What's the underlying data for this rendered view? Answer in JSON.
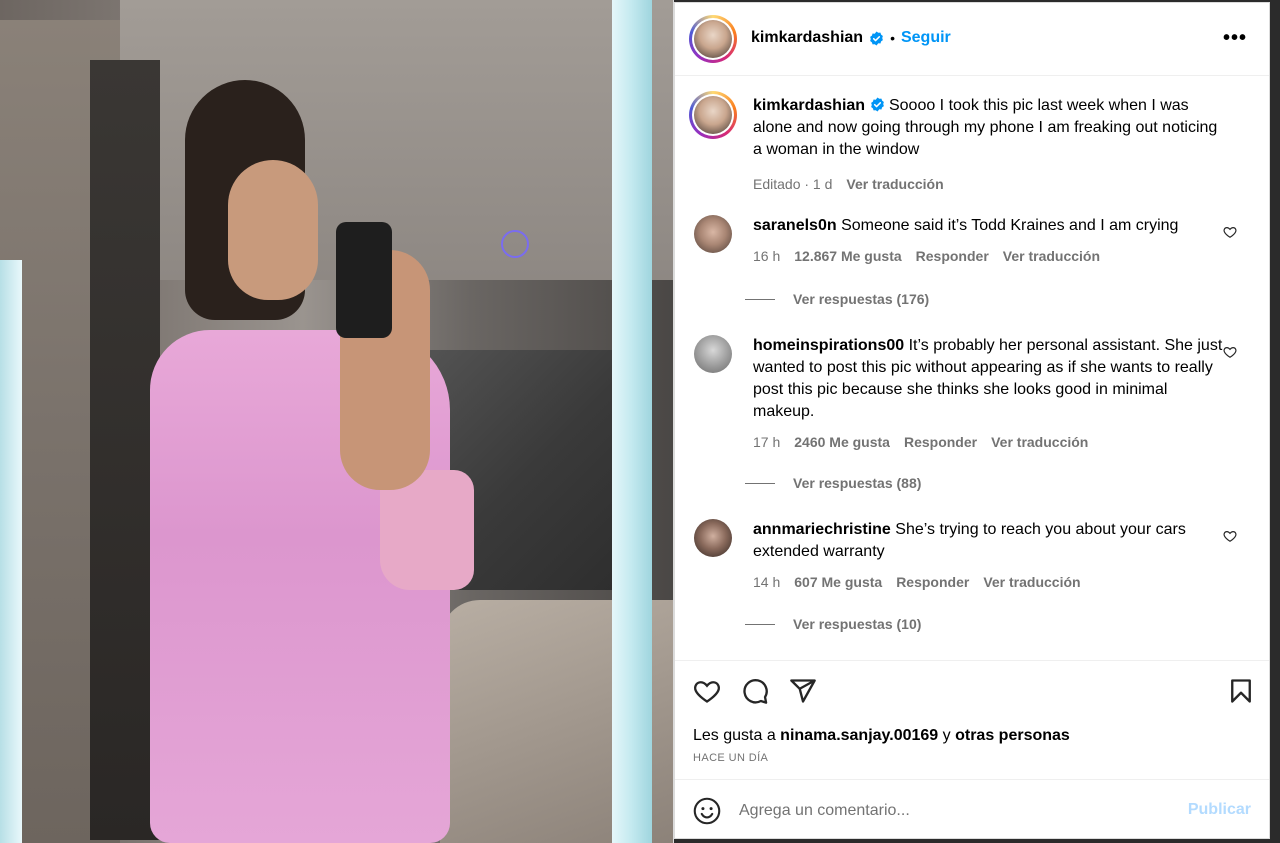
{
  "post": {
    "username": "kimkardashian",
    "follow_label": "Seguir",
    "separator": "•",
    "more_label": "•••"
  },
  "caption": {
    "username": "kimkardashian",
    "text": "Soooo I took this pic last week when I was alone and now going through my phone I am freaking out noticing a woman in the window",
    "edited": "Editado · 1 d",
    "translate": "Ver traducción"
  },
  "comments": [
    {
      "username": "saranels0n",
      "text": "Someone said it’s Todd Kraines and I am crying",
      "time": "16 h",
      "likes": "12.867 Me gusta",
      "reply": "Responder",
      "translate": "Ver traducción",
      "replies": "Ver respuestas (176)"
    },
    {
      "username": "homeinspirations00",
      "text": "It’s probably her personal assistant. She just wanted to post this pic without appearing as if she wants to really post this pic because she thinks she looks good in minimal makeup.",
      "time": "17 h",
      "likes": "2460 Me gusta",
      "reply": "Responder",
      "translate": "Ver traducción",
      "replies": "Ver respuestas (88)"
    },
    {
      "username": "annmariechristine",
      "text": "She’s trying to reach you about your cars extended warranty",
      "time": "14 h",
      "likes": "607 Me gusta",
      "reply": "Responder",
      "translate": "Ver traducción",
      "replies": "Ver respuestas (10)"
    }
  ],
  "likes": {
    "prefix": "Les gusta a ",
    "user": "ninama.sanjay.00169",
    "middle": " y ",
    "others": "otras personas"
  },
  "when": "HACE UN DÍA",
  "composer": {
    "placeholder": "Agrega un comentario...",
    "publish": "Publicar"
  },
  "colors": {
    "accent": "#0095f6",
    "muted": "#737373",
    "publish_disabled": "#b3dbff"
  }
}
